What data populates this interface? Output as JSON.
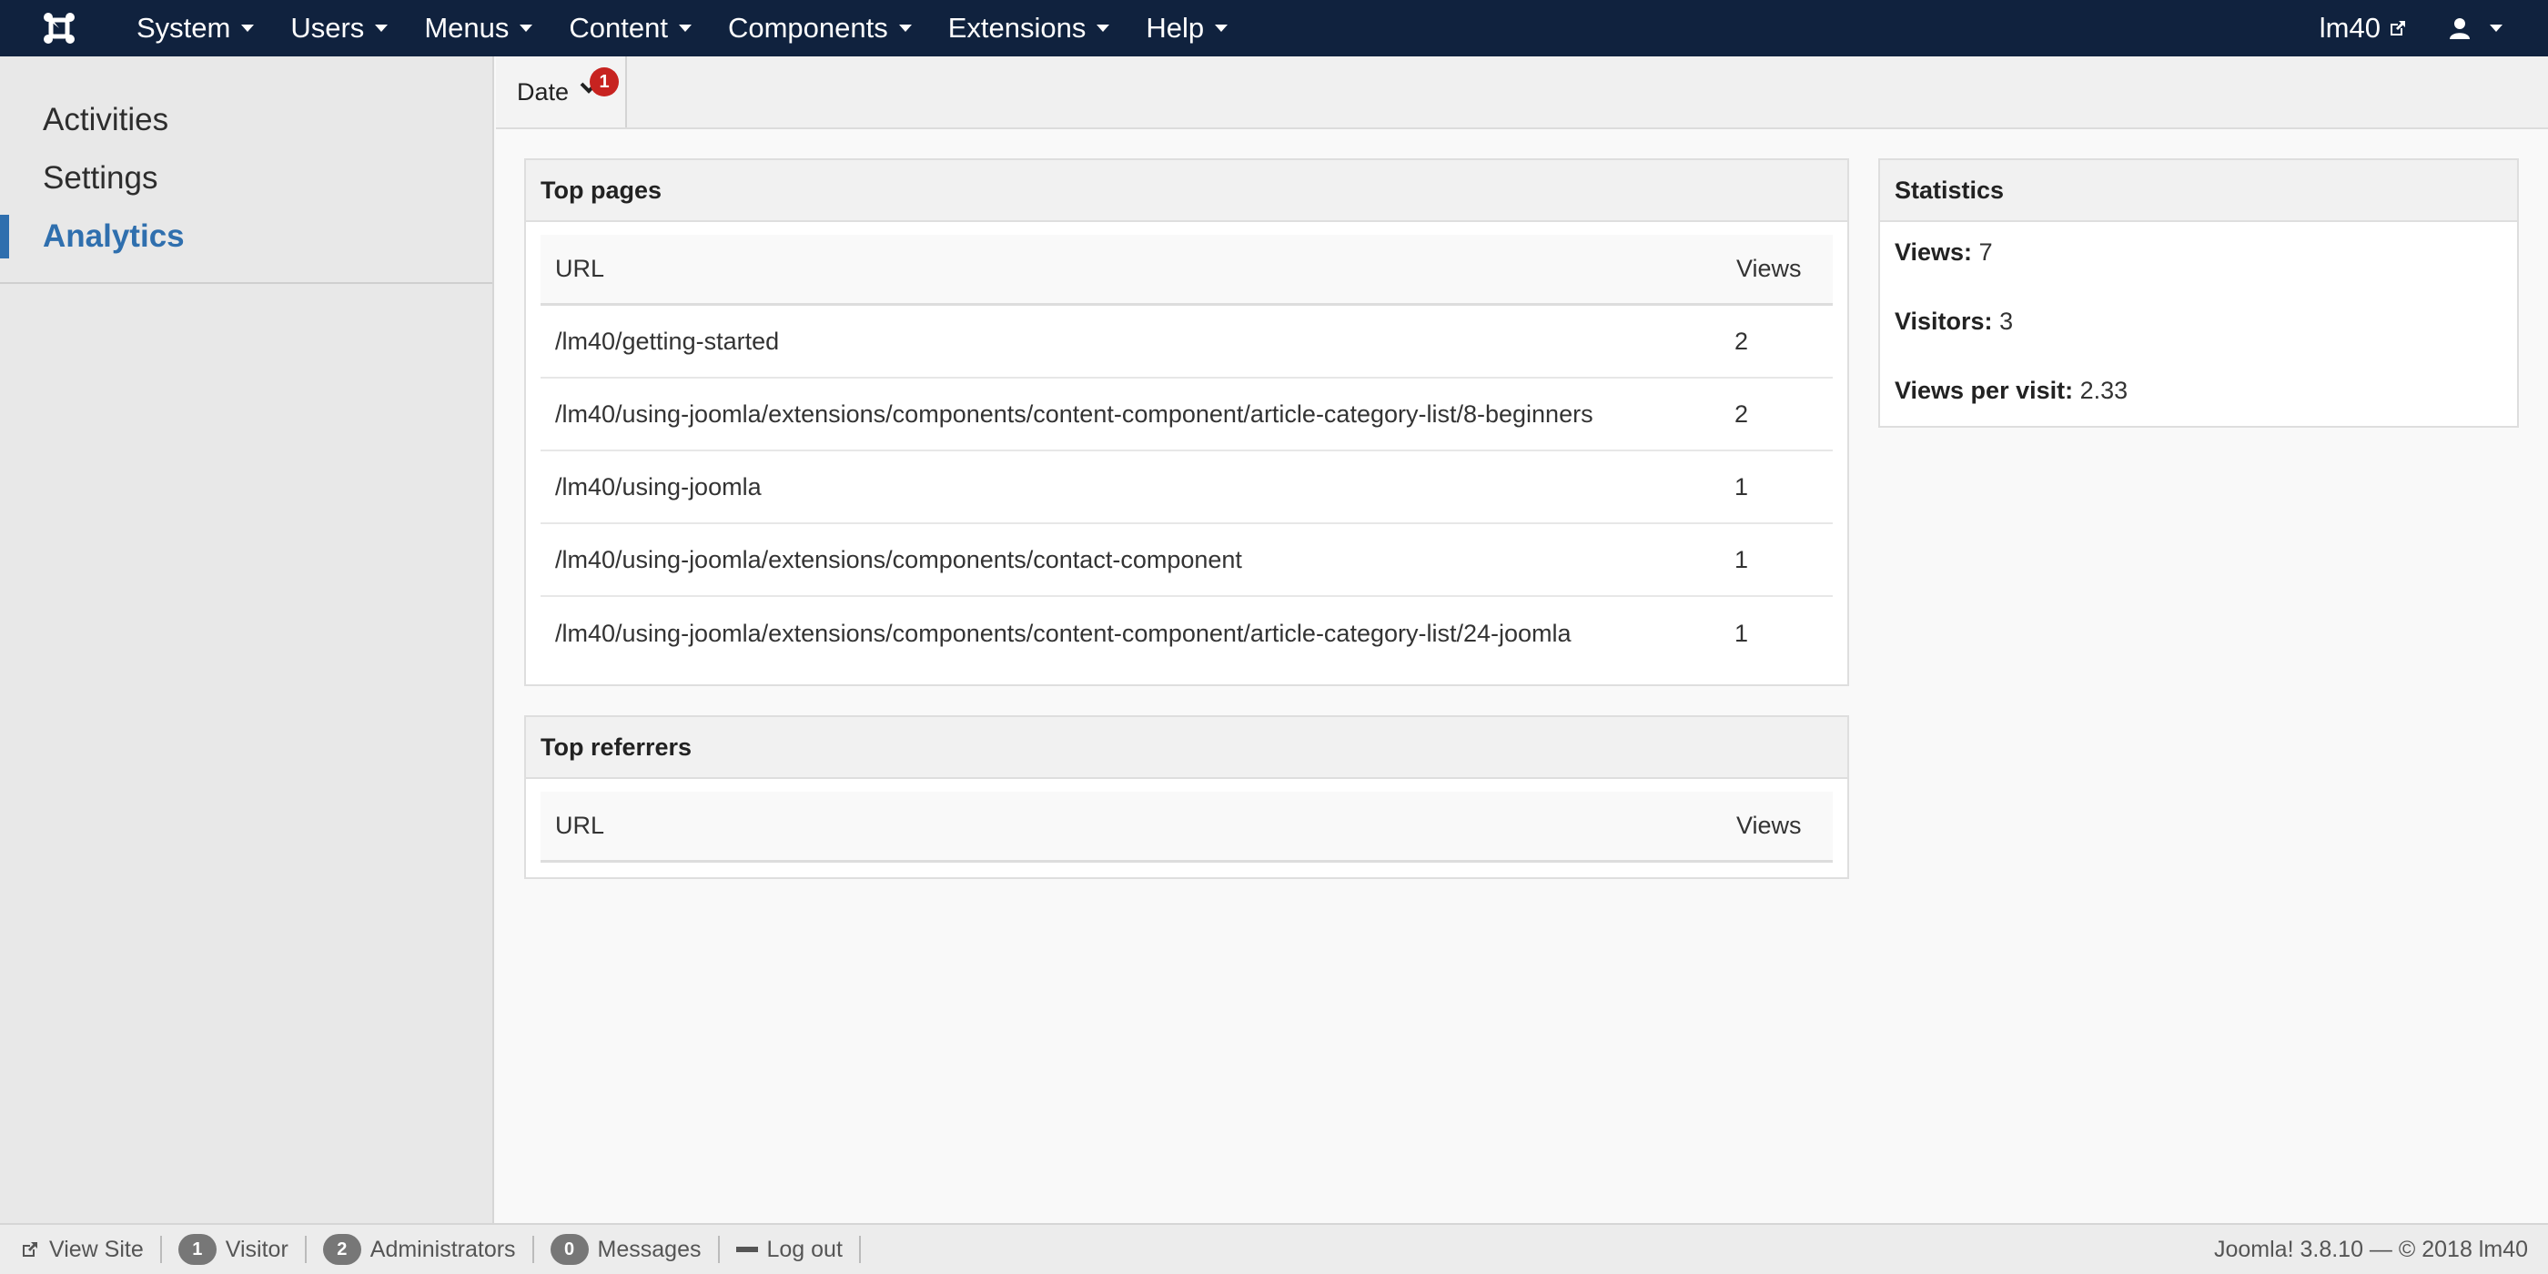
{
  "navbar": {
    "brand_icon": "joomla-logo-icon",
    "menus": [
      {
        "label": "System"
      },
      {
        "label": "Users"
      },
      {
        "label": "Menus"
      },
      {
        "label": "Content"
      },
      {
        "label": "Components"
      },
      {
        "label": "Extensions"
      },
      {
        "label": "Help"
      }
    ],
    "site_name": "lm40",
    "site_icon": "external-link-icon",
    "user_icon": "user-icon"
  },
  "sidebar": {
    "items": [
      {
        "label": "Activities",
        "active": false
      },
      {
        "label": "Settings",
        "active": false
      },
      {
        "label": "Analytics",
        "active": true
      }
    ]
  },
  "toolbar": {
    "date_label": "Date",
    "date_badge": "1"
  },
  "top_pages": {
    "title": "Top pages",
    "col_url": "URL",
    "col_views": "Views",
    "rows": [
      {
        "url": "/lm40/getting-started",
        "views": "2"
      },
      {
        "url": "/lm40/using-joomla/extensions/components/content-component/article-category-list/8-beginners",
        "views": "2"
      },
      {
        "url": "/lm40/using-joomla",
        "views": "1"
      },
      {
        "url": "/lm40/using-joomla/extensions/components/contact-component",
        "views": "1"
      },
      {
        "url": "/lm40/using-joomla/extensions/components/content-component/article-category-list/24-joomla",
        "views": "1"
      }
    ]
  },
  "top_referrers": {
    "title": "Top referrers",
    "col_url": "URL",
    "col_views": "Views"
  },
  "statistics": {
    "title": "Statistics",
    "views_label": "Views:",
    "views_value": "7",
    "visitors_label": "Visitors:",
    "visitors_value": "3",
    "vpv_label": "Views per visit:",
    "vpv_value": "2.33"
  },
  "statusbar": {
    "view_site": "View Site",
    "visitor_count": "1",
    "visitor_label": "Visitor",
    "admin_count": "2",
    "admin_label": "Administrators",
    "messages_count": "0",
    "messages_label": "Messages",
    "logout": "Log out",
    "version": "Joomla! 3.8.10  —  © 2018 lm40"
  },
  "colors": {
    "navbar_bg": "#10223e",
    "accent": "#2f6fae",
    "badge_red": "#c72320"
  }
}
